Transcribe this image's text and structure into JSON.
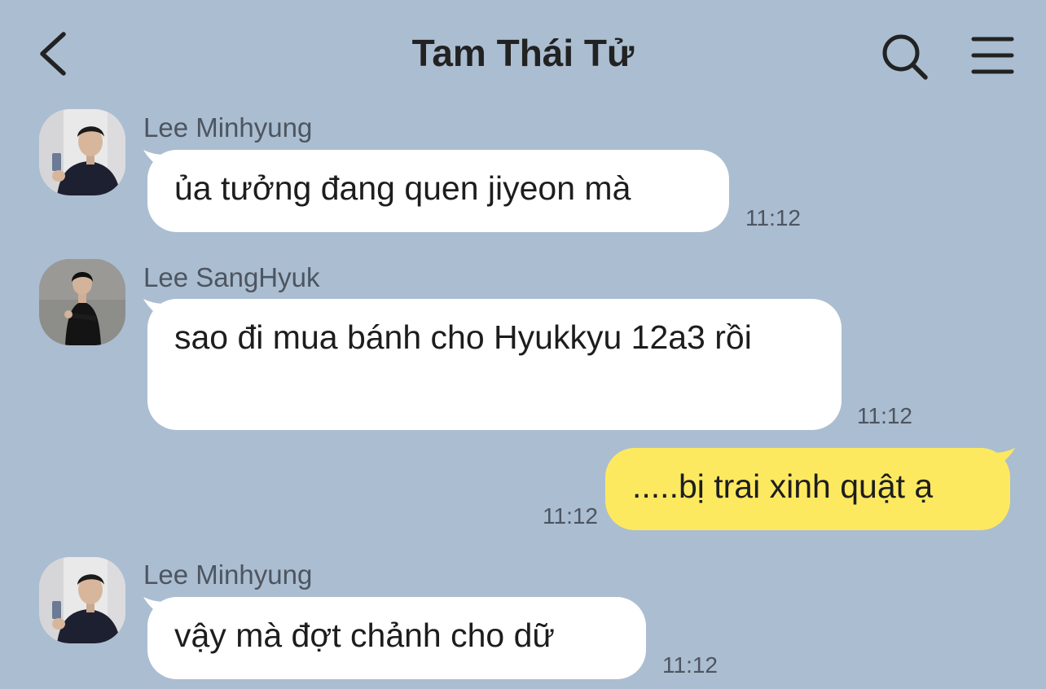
{
  "header": {
    "title": "Tam Thái Tử",
    "back_icon": "chevron-left-icon",
    "search_icon": "search-icon",
    "menu_icon": "hamburger-menu-icon"
  },
  "colors": {
    "background": "#abbdd1",
    "incoming_bubble": "#ffffff",
    "outgoing_bubble": "#fde960"
  },
  "messages": [
    {
      "sender": "Lee Minhyung",
      "text": "ủa tưởng đang quen jiyeon mà",
      "time": "11:12",
      "direction": "incoming"
    },
    {
      "sender": "Lee SangHyuk",
      "text": "sao đi mua bánh cho Hyukkyu 12a3 rồi",
      "time": "11:12",
      "direction": "incoming"
    },
    {
      "sender": "",
      "text": ".....bị trai xinh quật ạ",
      "time": "11:12",
      "direction": "outgoing"
    },
    {
      "sender": "Lee Minhyung",
      "text": "vậy mà đợt chảnh cho dữ",
      "time": "11:12",
      "direction": "incoming"
    }
  ]
}
